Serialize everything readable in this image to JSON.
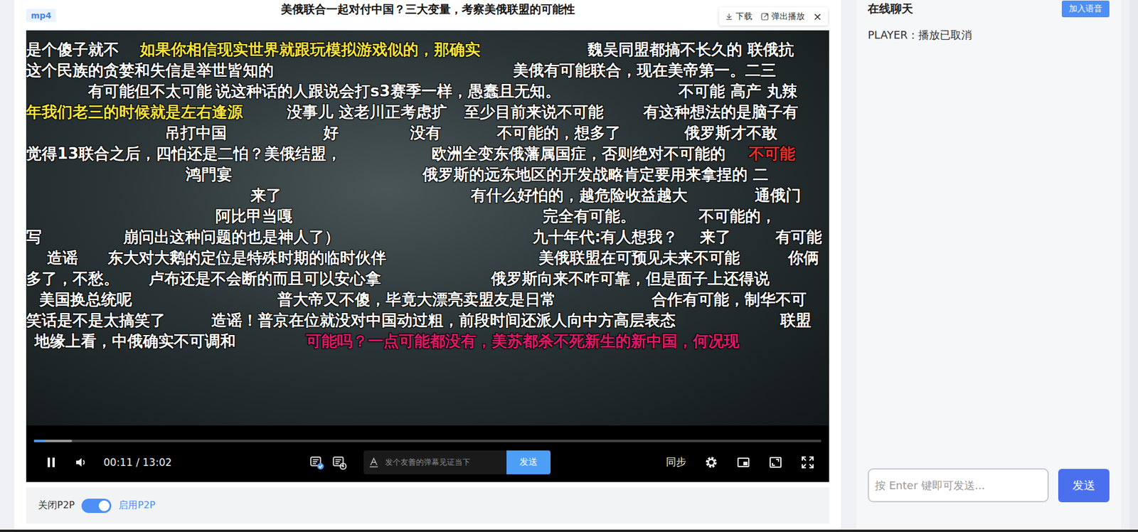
{
  "header": {
    "badge": "mp4",
    "title": "美俄联合一起对付中国？三大变量，考察美俄联盟的可能性"
  },
  "toolbar": {
    "download": "下载",
    "popout": "弹出播放",
    "close": "×"
  },
  "danmaku": {
    "rows": [
      [
        {
          "text": "是个傻子就不",
          "color": "#ffffff"
        },
        {
          "text": "如果你相信现实世界就跟玩模拟游戏似的，那确实",
          "color": "#f7e43a"
        },
        {
          "text": "魏吴同盟都搞不长久的 联俄抗",
          "color": "#ffffff"
        }
      ],
      [
        {
          "text": "这个民族的贪婪和失信是举世皆知的",
          "color": "#ffffff"
        },
        {
          "text": "美俄有可能联合，现在美帝第一。二三",
          "color": "#ffffff"
        }
      ],
      [
        {
          "text": "有可能但不太可能",
          "color": "#ffffff"
        },
        {
          "text": "说这种话的人跟说会打s3赛季一样，愚蠢且无知。",
          "color": "#ffffff"
        },
        {
          "text": "不可能  高产 丸辣",
          "color": "#ffffff"
        }
      ],
      [
        {
          "text": "年我们老三的时候就是左右逢源",
          "color": "#f7e43a"
        },
        {
          "text": "没事儿 这老川正考虑扩",
          "color": "#ffffff"
        },
        {
          "text": "至少目前来说不可能",
          "color": "#ffffff"
        },
        {
          "text": "有这种想法的是脑子有",
          "color": "#ffffff"
        }
      ],
      [
        {
          "text": "吊打中国",
          "color": "#ffffff"
        },
        {
          "text": "好",
          "color": "#ffffff"
        },
        {
          "text": "没有",
          "color": "#ffffff"
        },
        {
          "text": "不可能的，想多了",
          "color": "#ffffff"
        },
        {
          "text": "俄罗斯才不敢",
          "color": "#ffffff"
        }
      ],
      [
        {
          "text": "觉得13联合之后，四怕还是二怕？美俄结盟，",
          "color": "#ffffff"
        },
        {
          "text": "欧洲全变东俄藩属国症，否则绝对不可能的",
          "color": "#ffffff"
        },
        {
          "text": "不可能",
          "color": "#e8302a"
        }
      ],
      [
        {
          "text": "鸿門宴",
          "color": "#ffffff"
        },
        {
          "text": "俄罗斯的远东地区的开发战略肯定要用来拿捏的 二",
          "color": "#ffffff"
        }
      ],
      [
        {
          "text": "来了",
          "color": "#ffffff"
        },
        {
          "text": "有什么好怕的，越危险收益越大",
          "color": "#ffffff"
        },
        {
          "text": "通俄门",
          "color": "#ffffff"
        }
      ],
      [
        {
          "text": "阿比甲当嘎",
          "color": "#ffffff"
        },
        {
          "text": "完全有可能。",
          "color": "#ffffff"
        },
        {
          "text": "不可能的，",
          "color": "#ffffff"
        }
      ],
      [
        {
          "text": "写",
          "color": "#ffffff"
        },
        {
          "text": "崩问出这种问题的也是神人了）",
          "color": "#ffffff"
        },
        {
          "text": "九十年代:有人想我？",
          "color": "#ffffff"
        },
        {
          "text": "来了",
          "color": "#ffffff"
        },
        {
          "text": "有可能",
          "color": "#ffffff"
        }
      ],
      [
        {
          "text": "造谣",
          "color": "#ffffff"
        },
        {
          "text": "东大对大鹅的定位是特殊时期的临时伙伴",
          "color": "#ffffff"
        },
        {
          "text": "美俄联盟在可预见未来不可能",
          "color": "#ffffff"
        },
        {
          "text": "你俩",
          "color": "#ffffff"
        }
      ],
      [
        {
          "text": "多了，不愁。",
          "color": "#ffffff"
        },
        {
          "text": "卢布还是不会断的而且可以安心拿",
          "color": "#ffffff"
        },
        {
          "text": "俄罗斯向来不咋可靠，但是面子上还得说",
          "color": "#ffffff"
        }
      ],
      [
        {
          "text": "美国换总统呢",
          "color": "#ffffff"
        },
        {
          "text": "普大帝又不傻，毕竟大漂亮卖盟友是日常",
          "color": "#ffffff"
        },
        {
          "text": "合作有可能，制华不可",
          "color": "#ffffff"
        }
      ],
      [
        {
          "text": "笑话是不是太搞笑了",
          "color": "#ffffff"
        },
        {
          "text": "造谣！普京在位就没对中国动过粗，前段时间还派人向中方高层表态",
          "color": "#ffffff"
        },
        {
          "text": "联盟",
          "color": "#ffffff"
        }
      ],
      [
        {
          "text": "地缘上看，中俄确实不可调和",
          "color": "#ffffff"
        },
        {
          "text": "可能吗？一点可能都没有，美苏都杀不死新生的新中国，何况现",
          "color": "#e0186c"
        }
      ]
    ]
  },
  "controls": {
    "playing": true,
    "time": "00:11 / 13:02",
    "progress": {
      "level": 0.014
    },
    "buffered": {
      "level": 0.048
    },
    "danmaku_on": true,
    "input_placeholder": "发个友善的弹幕见证当下",
    "send": "发送",
    "sync": "同步"
  },
  "p2p": {
    "off_label": "关闭P2P",
    "on_label": "启用P2P",
    "on": true
  },
  "chat": {
    "title": "在线聊天",
    "voice_button": "加入语音",
    "messages": [
      "PLAYER：播放已取消"
    ],
    "input_placeholder": "按 Enter 键即可发送...",
    "send": "发送"
  }
}
